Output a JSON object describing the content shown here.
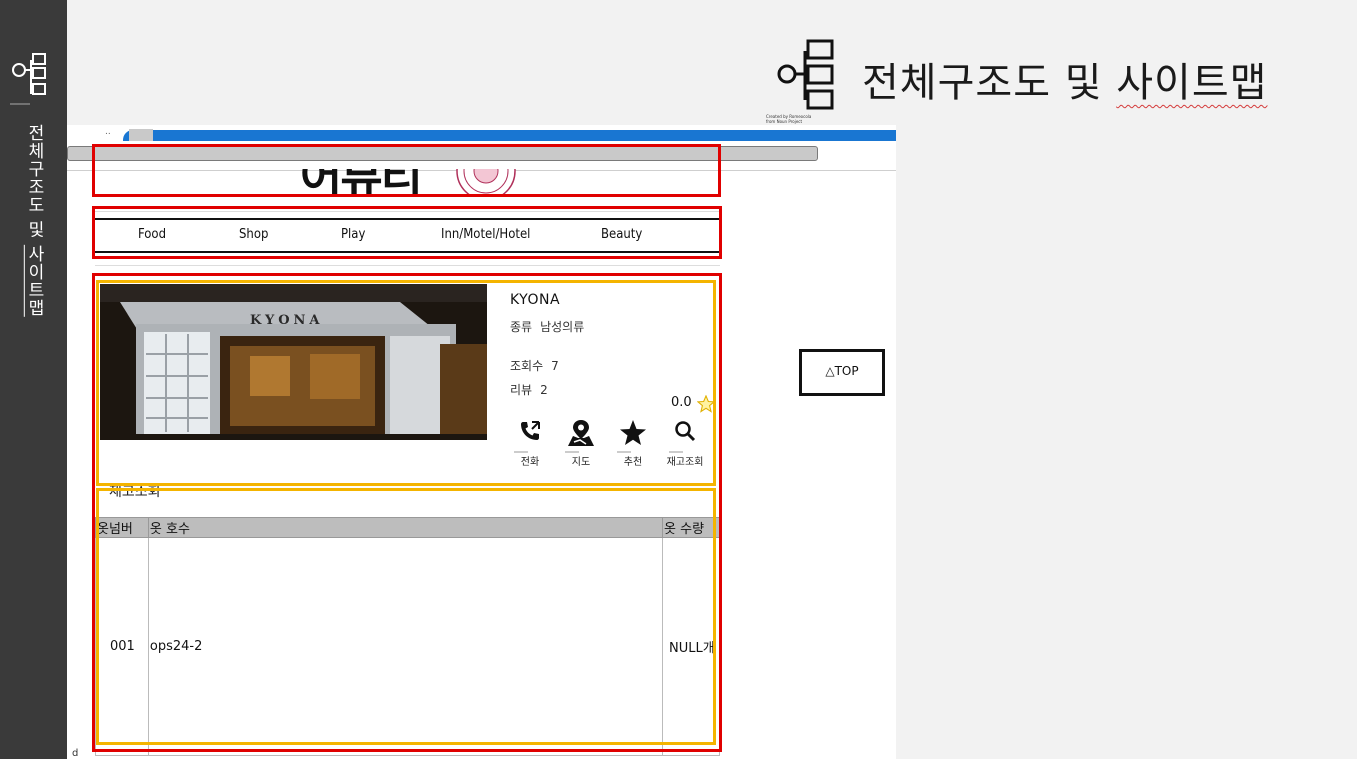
{
  "sidebar": {
    "title_prefix": "전체구조도 및 ",
    "title_underlined": "사이트맵",
    "icon": "sitemap-icon"
  },
  "heading": {
    "title_prefix": "전체구조도 및 ",
    "title_underlined": "사이트맵",
    "icon": "sitemap-icon",
    "credit_line1": "Created by Romeocola",
    "credit_line2": "from Noun Project"
  },
  "browser": {
    "tab_dots": "..",
    "logo_text": "어뷰티"
  },
  "nav": {
    "items": [
      "Food",
      "Shop",
      "Play",
      "Inn/Motel/Hotel",
      "Beauty"
    ]
  },
  "store": {
    "sign": "KYONA",
    "name": "KYONA",
    "category_label": "종류",
    "category_value": "남성의류",
    "views_label": "조회수",
    "views_value": "7",
    "reviews_label": "리뷰",
    "reviews_value": "2",
    "rating": "0.0",
    "actions": [
      {
        "label": "전화",
        "icon": "phone-icon"
      },
      {
        "label": "지도",
        "icon": "map-pin-icon"
      },
      {
        "label": "추천",
        "icon": "star-icon"
      },
      {
        "label": "재고조회",
        "icon": "search-icon"
      }
    ]
  },
  "stock": {
    "title": "재고조회",
    "columns": [
      "옷넘버",
      "옷 호수",
      "옷 수량"
    ],
    "rows": [
      {
        "number": "001",
        "size": "ops24-2",
        "qty": "NULL개"
      }
    ]
  },
  "top_button": {
    "label": "△TOP"
  },
  "colors": {
    "annotation_red": "#e00000",
    "annotation_yellow": "#f4b400",
    "tab_blue": "#1976d2",
    "sidebar_dark": "#3a3a3a"
  },
  "stray_char": "d"
}
